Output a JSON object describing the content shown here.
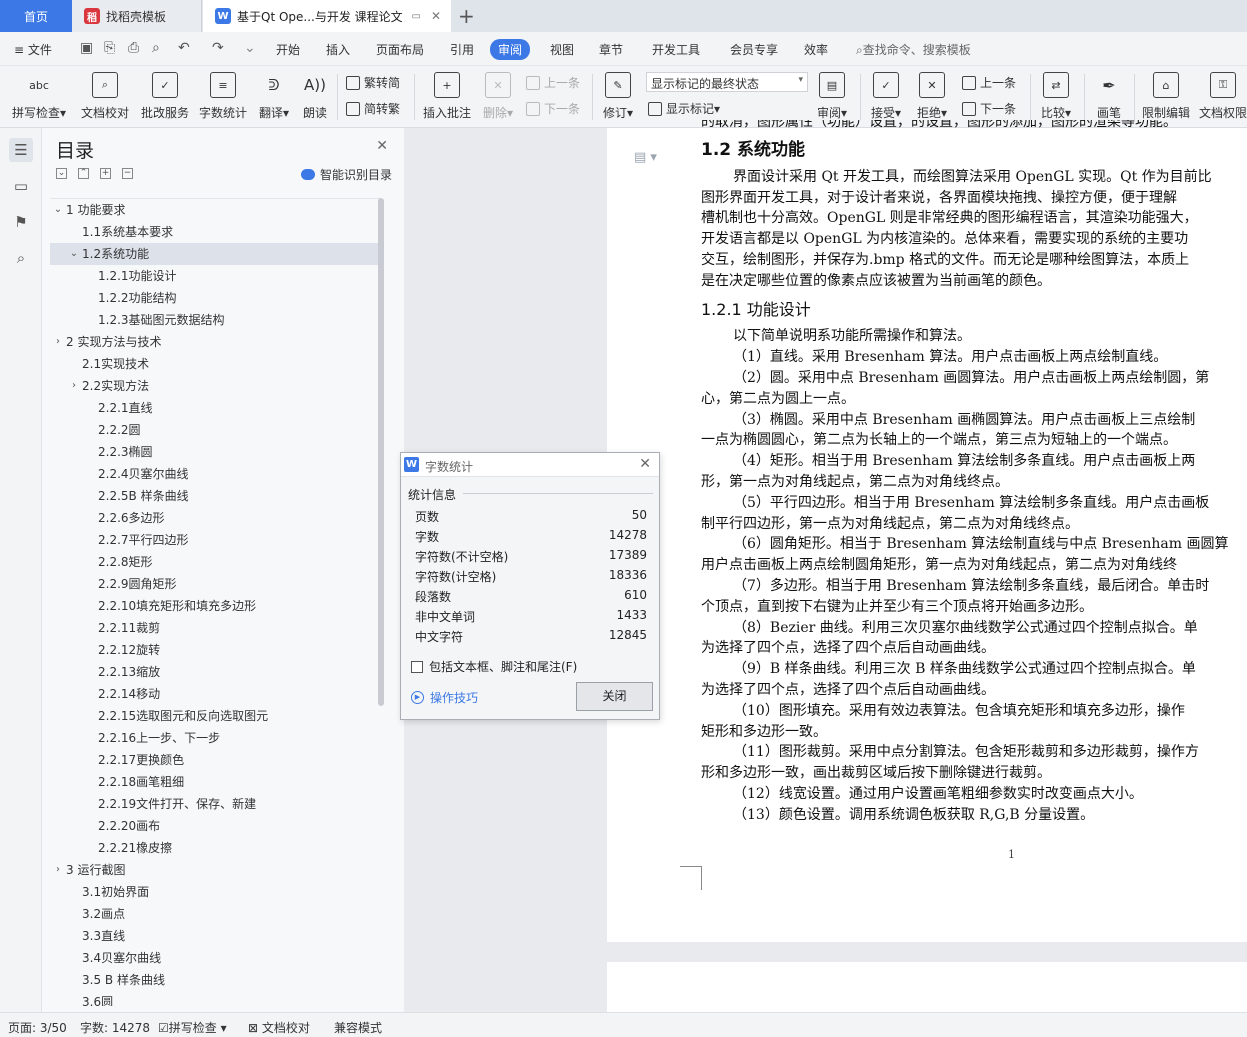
{
  "tabs": {
    "home": "首页",
    "template": "找稻壳模板",
    "document": "基于Qt Ope...与开发 课程论文"
  },
  "menu": {
    "file": "文件",
    "items": [
      "开始",
      "插入",
      "页面布局",
      "引用",
      "审阅",
      "视图",
      "章节",
      "开发工具",
      "会员专享",
      "效率"
    ],
    "active": "审阅",
    "search_placeholder": "查找命令、搜索模板"
  },
  "ribbon": {
    "spellcheck": "拼写检查",
    "doc_proof": "文档校对",
    "batch_service": "批改服务",
    "word_count": "字数统计",
    "translate": "翻译",
    "read_aloud": "朗读",
    "trad_to_simp": "繁转简",
    "simp_to_trad": "简转繁",
    "insert_comment": "插入批注",
    "delete": "删除",
    "prev_comment": "上一条",
    "next_comment": "下一条",
    "revise": "修订",
    "markup_combo": "显示标记的最终状态",
    "show_markup": "显示标记",
    "review": "审阅",
    "accept": "接受",
    "reject": "拒绝",
    "prev_change": "上一条",
    "next_change": "下一条",
    "compare": "比较",
    "pen": "画笔",
    "restrict_edit": "限制编辑",
    "doc_perm": "文档权限"
  },
  "toc": {
    "title": "目录",
    "smart_label": "智能识别目录",
    "items": [
      {
        "text": "1 功能要求",
        "level": 1,
        "twisty": "v"
      },
      {
        "text": "1.1系统基本要求",
        "level": 2,
        "twisty": ""
      },
      {
        "text": "1.2系统功能",
        "level": 2,
        "twisty": "v",
        "selected": true
      },
      {
        "text": "1.2.1功能设计",
        "level": 3,
        "twisty": ""
      },
      {
        "text": "1.2.2功能结构",
        "level": 3,
        "twisty": ""
      },
      {
        "text": "1.2.3基础图元数据结构",
        "level": 3,
        "twisty": ""
      },
      {
        "text": "2 实现方法与技术",
        "level": 1,
        "twisty": ">"
      },
      {
        "text": "2.1实现技术",
        "level": 2,
        "twisty": ""
      },
      {
        "text": "2.2实现方法",
        "level": 2,
        "twisty": ">"
      },
      {
        "text": "2.2.1直线",
        "level": 3,
        "twisty": ""
      },
      {
        "text": "2.2.2圆",
        "level": 3,
        "twisty": ""
      },
      {
        "text": "2.2.3椭圆",
        "level": 3,
        "twisty": ""
      },
      {
        "text": "2.2.4贝塞尔曲线",
        "level": 3,
        "twisty": ""
      },
      {
        "text": "2.2.5B 样条曲线",
        "level": 3,
        "twisty": ""
      },
      {
        "text": "2.2.6多边形",
        "level": 3,
        "twisty": ""
      },
      {
        "text": "2.2.7平行四边形",
        "level": 3,
        "twisty": ""
      },
      {
        "text": "2.2.8矩形",
        "level": 3,
        "twisty": ""
      },
      {
        "text": "2.2.9圆角矩形",
        "level": 3,
        "twisty": ""
      },
      {
        "text": "2.2.10填充矩形和填充多边形",
        "level": 3,
        "twisty": ""
      },
      {
        "text": "2.2.11裁剪",
        "level": 3,
        "twisty": ""
      },
      {
        "text": "2.2.12旋转",
        "level": 3,
        "twisty": ""
      },
      {
        "text": "2.2.13缩放",
        "level": 3,
        "twisty": ""
      },
      {
        "text": "2.2.14移动",
        "level": 3,
        "twisty": ""
      },
      {
        "text": "2.2.15选取图元和反向选取图元",
        "level": 3,
        "twisty": ""
      },
      {
        "text": "2.2.16上一步、下一步",
        "level": 3,
        "twisty": ""
      },
      {
        "text": "2.2.17更换颜色",
        "level": 3,
        "twisty": ""
      },
      {
        "text": "2.2.18画笔粗细",
        "level": 3,
        "twisty": ""
      },
      {
        "text": "2.2.19文件打开、保存、新建",
        "level": 3,
        "twisty": ""
      },
      {
        "text": "2.2.20画布",
        "level": 3,
        "twisty": ""
      },
      {
        "text": "2.2.21橡皮擦",
        "level": 3,
        "twisty": ""
      },
      {
        "text": "3 运行截图",
        "level": 1,
        "twisty": ">"
      },
      {
        "text": "3.1初始界面",
        "level": 2,
        "twisty": ""
      },
      {
        "text": "3.2画点",
        "level": 2,
        "twisty": ""
      },
      {
        "text": "3.3直线",
        "level": 2,
        "twisty": ""
      },
      {
        "text": "3.4贝塞尔曲线",
        "level": 2,
        "twisty": ""
      },
      {
        "text": "3.5  B 样条曲线",
        "level": 2,
        "twisty": ""
      },
      {
        "text": "3.6圆",
        "level": 2,
        "twisty": ""
      }
    ]
  },
  "document": {
    "top_fragment": "的取消，图形属性（功能）设置，的设置，图形的添加，图形的渲染等功能。",
    "h2": "1.2  系统功能",
    "para1": [
      "界面设计采用 Qt 开发工具，而绘图算法采用 OpenGL 实现。Qt 作为目前比",
      "图形界面开发工具，对于设计者来说，各界面模块拖拽、操控方便，便于理解",
      "槽机制也十分高效。OpenGL 则是非常经典的图形编程语言，其渲染功能强大，",
      "开发语言都是以 OpenGL 为内核渲染的。总体来看，需要实现的系统的主要功",
      "交互，绘制图形，并保存为.bmp 格式的文件。而无论是哪种绘图算法，本质上",
      "是在决定哪些位置的像素点应该被置为当前画笔的颜色。"
    ],
    "h3": "1.2.1  功能设计",
    "lines": [
      {
        "t": "以下简单说明系功能所需操作和算法。",
        "ind": true
      },
      {
        "t": "（1）直线。采用 Bresenham 算法。用户点击画板上两点绘制直线。",
        "ind": true
      },
      {
        "t": "（2）圆。采用中点 Bresenham 画圆算法。用户点击画板上两点绘制圆，第",
        "ind": true
      },
      {
        "t": "心，第二点为圆上一点。",
        "ind": false
      },
      {
        "t": "（3）椭圆。采用中点 Bresenham 画椭圆算法。用户点击画板上三点绘制",
        "ind": true
      },
      {
        "t": "一点为椭圆圆心，第二点为长轴上的一个端点，第三点为短轴上的一个端点。",
        "ind": false
      },
      {
        "t": "（4）矩形。相当于用 Bresenham 算法绘制多条直线。用户点击画板上两",
        "ind": true
      },
      {
        "t": "形，第一点为对角线起点，第二点为对角线终点。",
        "ind": false
      },
      {
        "t": "（5）平行四边形。相当于用 Bresenham 算法绘制多条直线。用户点击画板",
        "ind": true
      },
      {
        "t": "制平行四边形，第一点为对角线起点，第二点为对角线终点。",
        "ind": false
      },
      {
        "t": "（6）圆角矩形。相当于 Bresenham 算法绘制直线与中点 Bresenham 画圆算",
        "ind": true
      },
      {
        "t": "用户点击画板上两点绘制圆角矩形，第一点为对角线起点，第二点为对角线终",
        "ind": false
      },
      {
        "t": "（7）多边形。相当于用 Bresenham 算法绘制多条直线，最后闭合。单击时",
        "ind": true
      },
      {
        "t": "个顶点，直到按下右键为止并至少有三个顶点将开始画多边形。",
        "ind": false
      },
      {
        "t": "（8）Bezier 曲线。利用三次贝塞尔曲线数学公式通过四个控制点拟合。单",
        "ind": true
      },
      {
        "t": "为选择了四个点，选择了四个点后自动画曲线。",
        "ind": false
      },
      {
        "t": "（9）B 样条曲线。利用三次 B 样条曲线数学公式通过四个控制点拟合。单",
        "ind": true
      },
      {
        "t": "为选择了四个点，选择了四个点后自动画曲线。",
        "ind": false
      },
      {
        "t": "（10）图形填充。采用有效边表算法。包含填充矩形和填充多边形，操作",
        "ind": true
      },
      {
        "t": "矩形和多边形一致。",
        "ind": false
      },
      {
        "t": "（11）图形裁剪。采用中点分割算法。包含矩形裁剪和多边形裁剪，操作方",
        "ind": true
      },
      {
        "t": "形和多边形一致，画出裁剪区域后按下删除键进行裁剪。",
        "ind": false
      },
      {
        "t": "（12）线宽设置。通过用户设置画笔粗细参数实时改变画点大小。",
        "ind": true
      },
      {
        "t": "（13）颜色设置。调用系统调色板获取 R,G,B 分量设置。",
        "ind": true
      }
    ],
    "page_number": "1"
  },
  "dialog": {
    "title": "字数统计",
    "section": "统计信息",
    "rows": [
      {
        "label": "页数",
        "value": "50"
      },
      {
        "label": "字数",
        "value": "14278"
      },
      {
        "label": "字符数(不计空格)",
        "value": "17389"
      },
      {
        "label": "字符数(计空格)",
        "value": "18336"
      },
      {
        "label": "段落数",
        "value": "610"
      },
      {
        "label": "非中文单词",
        "value": "1433"
      },
      {
        "label": "中文字符",
        "value": "12845"
      }
    ],
    "checkbox_label": "包括文本框、脚注和尾注(F)",
    "tips": "操作技巧",
    "close_button": "关闭"
  },
  "status": {
    "page": "页面: 3/50",
    "words": "字数: 14278",
    "spellcheck": "拼写检查",
    "proofread": "文档校对",
    "compat": "兼容模式"
  },
  "colors": {
    "accent": "#3c79e6",
    "tab_active_bg": "#3c79e6",
    "toc_selected": "#dde2ea"
  }
}
